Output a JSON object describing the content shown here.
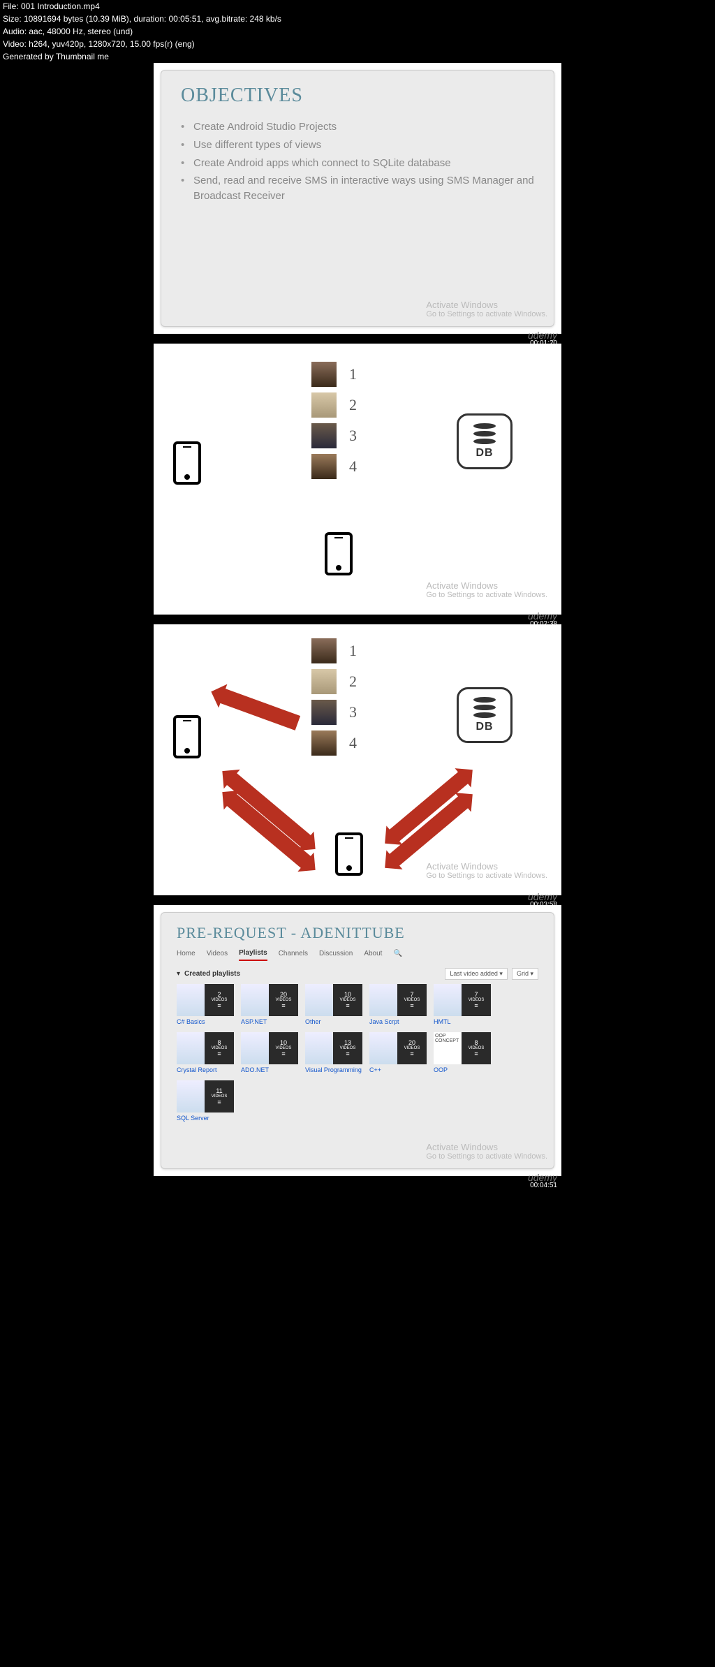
{
  "meta": {
    "file": "File: 001 Introduction.mp4",
    "size": "Size: 10891694 bytes (10.39 MiB), duration: 00:05:51, avg.bitrate: 248 kb/s",
    "audio": "Audio: aac, 48000 Hz, stereo (und)",
    "video": "Video: h264, yuv420p, 1280x720, 15.00 fps(r) (eng)",
    "gen": "Generated by Thumbnail me"
  },
  "watermark": {
    "title": "Activate Windows",
    "sub": "Go to Settings to activate Windows."
  },
  "brand": "udemy",
  "timecodes": [
    "00:01:20",
    "00:02:38",
    "00:03:58",
    "00:04:51"
  ],
  "slide1": {
    "title": "OBJECTIVES",
    "bullets": [
      "Create Android Studio Projects",
      "Use different types of views",
      "Create Android apps which connect to SQLite database",
      "Send, read and receive SMS in interactive ways using SMS Manager and Broadcast Receiver"
    ]
  },
  "list_numbers": [
    "1",
    "2",
    "3",
    "4"
  ],
  "db_label": "DB",
  "slide4": {
    "title": "PRE-REQUEST - ADENITTUBE",
    "tabs": [
      "Home",
      "Videos",
      "Playlists",
      "Channels",
      "Discussion",
      "About"
    ],
    "active_tab": "Playlists",
    "created": "Created playlists",
    "sort": "Last video added",
    "view": "Grid",
    "playlists": [
      {
        "t": "C# Basics",
        "n": "2"
      },
      {
        "t": "ASP.NET",
        "n": "20"
      },
      {
        "t": "Other",
        "n": "10"
      },
      {
        "t": "Java Scrpt",
        "n": "7"
      },
      {
        "t": "HMTL",
        "n": "7"
      },
      {
        "t": "Crystal Report",
        "n": "8"
      },
      {
        "t": "ADO.NET",
        "n": "10"
      },
      {
        "t": "Visual Programming",
        "n": "13"
      },
      {
        "t": "C++",
        "n": "20"
      },
      {
        "t": "OOP",
        "n": "8"
      },
      {
        "t": "SQL Server",
        "n": "11"
      }
    ],
    "videos_label": "VIDEOS",
    "oop_concept": "OOP CONCEPT"
  }
}
